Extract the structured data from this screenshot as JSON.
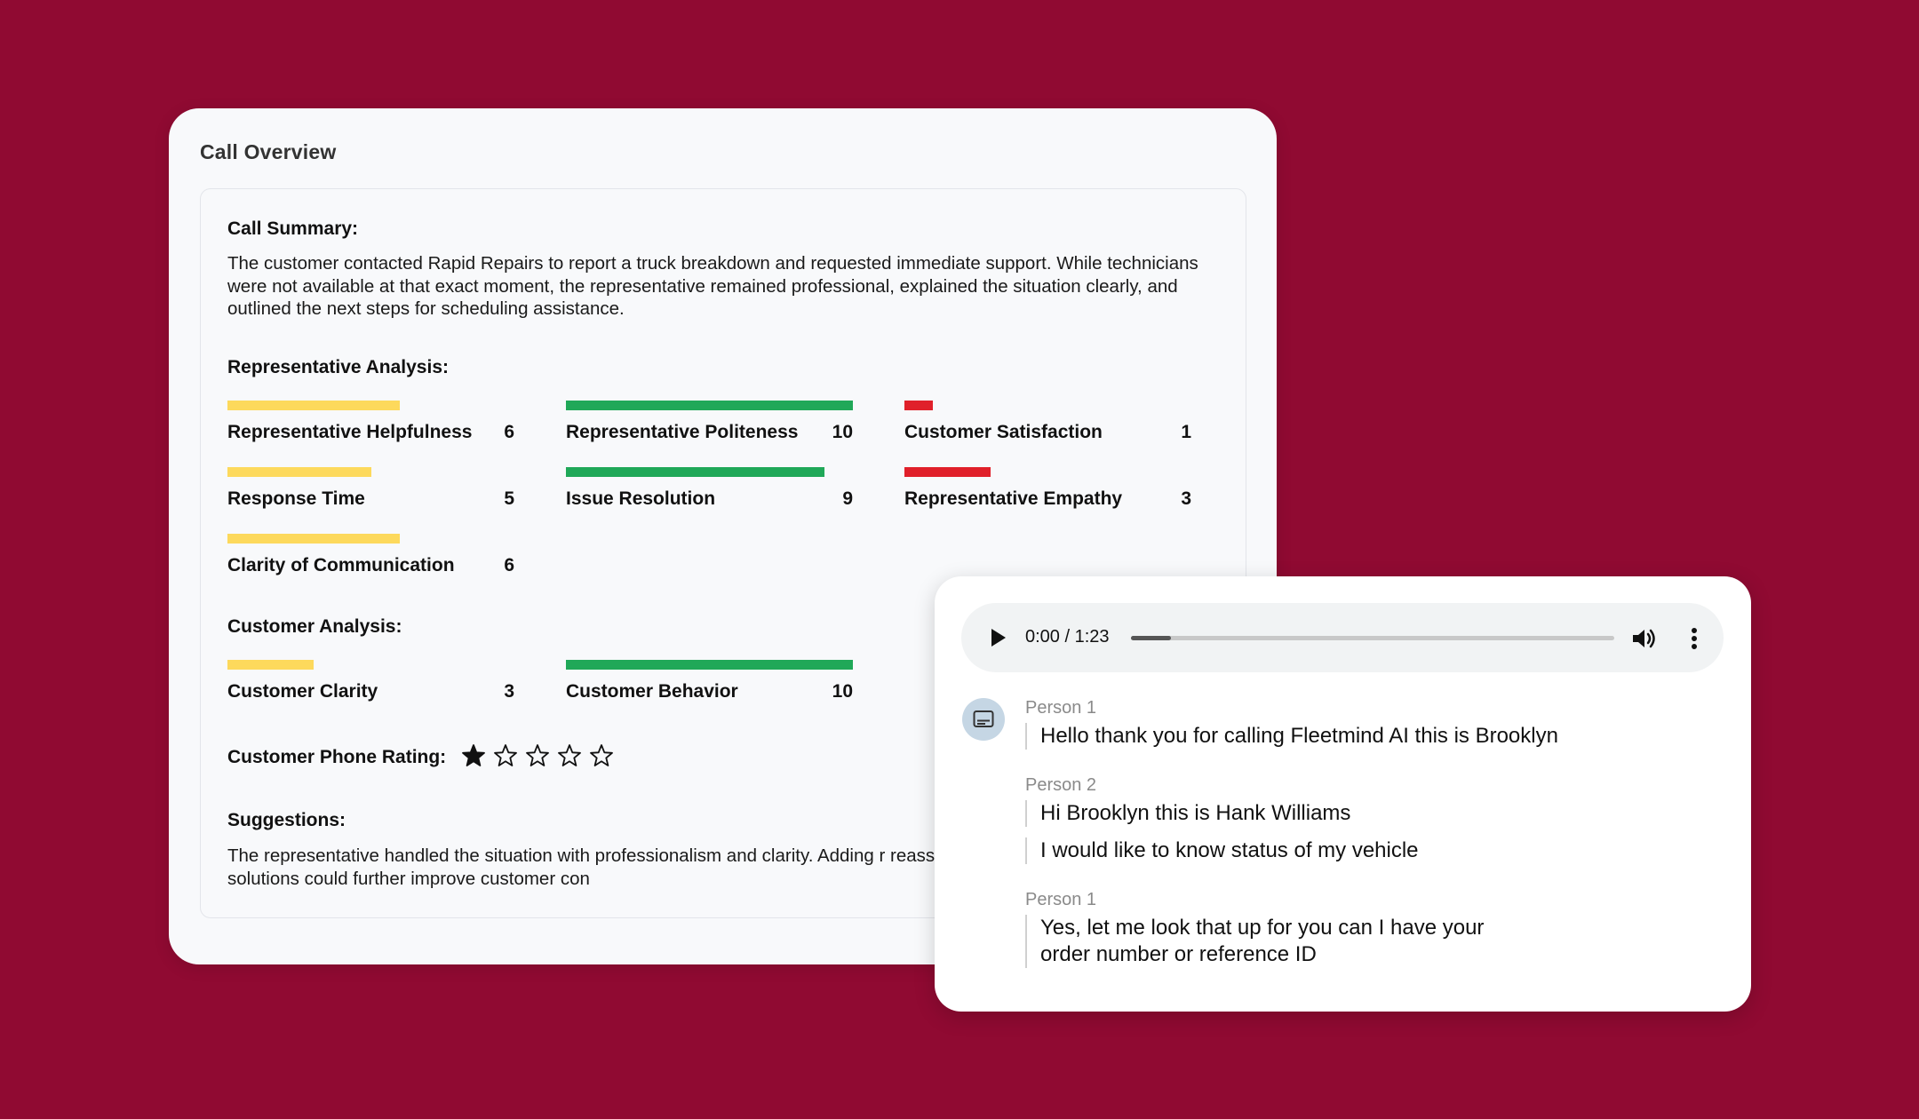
{
  "overview": {
    "title": "Call Overview",
    "summary_heading": "Call Summary:",
    "summary_text": "The customer contacted Rapid Repairs to report a truck breakdown and requested immediate support. While technicians were not available at that exact moment, the representative remained professional, explained the situation clearly, and outlined the next steps for scheduling assistance.",
    "rep_heading": "Representative Analysis:",
    "rep_metrics": [
      {
        "label": "Representative Helpfulness",
        "value": "6",
        "score": 6,
        "max": 10,
        "color": "#fdd95c"
      },
      {
        "label": "Representative Politeness",
        "value": "10",
        "score": 10,
        "max": 10,
        "color": "#20a858"
      },
      {
        "label": "Customer Satisfaction",
        "value": "1",
        "score": 1,
        "max": 10,
        "color": "#e0202a"
      },
      {
        "label": "Response Time",
        "value": "5",
        "score": 5,
        "max": 10,
        "color": "#fdd95c"
      },
      {
        "label": "Issue Resolution",
        "value": "9",
        "score": 9,
        "max": 10,
        "color": "#20a858"
      },
      {
        "label": "Representative Empathy",
        "value": "3",
        "score": 3,
        "max": 10,
        "color": "#e0202a"
      },
      {
        "label": "Clarity of Communication",
        "value": "6",
        "score": 6,
        "max": 10,
        "color": "#fdd95c"
      }
    ],
    "customer_heading": "Customer Analysis:",
    "customer_metrics": [
      {
        "label": "Customer Clarity",
        "value": "3",
        "score": 3,
        "max": 10,
        "color": "#fdd95c"
      },
      {
        "label": "Customer Behavior",
        "value": "10",
        "score": 10,
        "max": 10,
        "color": "#20a858"
      }
    ],
    "rating_label": "Customer Phone Rating:",
    "rating": 1,
    "rating_max": 5,
    "suggestions_heading": "Suggestions:",
    "suggestions_text": "The representative handled the situation with professionalism and clarity. Adding r reassurance, and offering alternative solutions could further improve customer con"
  },
  "player": {
    "time": "0:00 / 1:23",
    "progress_fraction": 0.083,
    "play_icon": "play-icon",
    "volume_icon": "volume-icon",
    "more_icon": "more-vertical-icon"
  },
  "transcript": {
    "icon": "subtitles-icon",
    "entries": [
      {
        "speaker": "Person 1",
        "lines": [
          "Hello thank you for calling Fleetmind AI this is Brooklyn"
        ]
      },
      {
        "speaker": "Person 2",
        "lines": [
          "Hi Brooklyn this is Hank Williams",
          "I would like to know status of my vehicle"
        ]
      },
      {
        "speaker": "Person 1",
        "lines": [
          "Yes, let me look that up for you can I have your order number or reference ID"
        ]
      }
    ]
  }
}
